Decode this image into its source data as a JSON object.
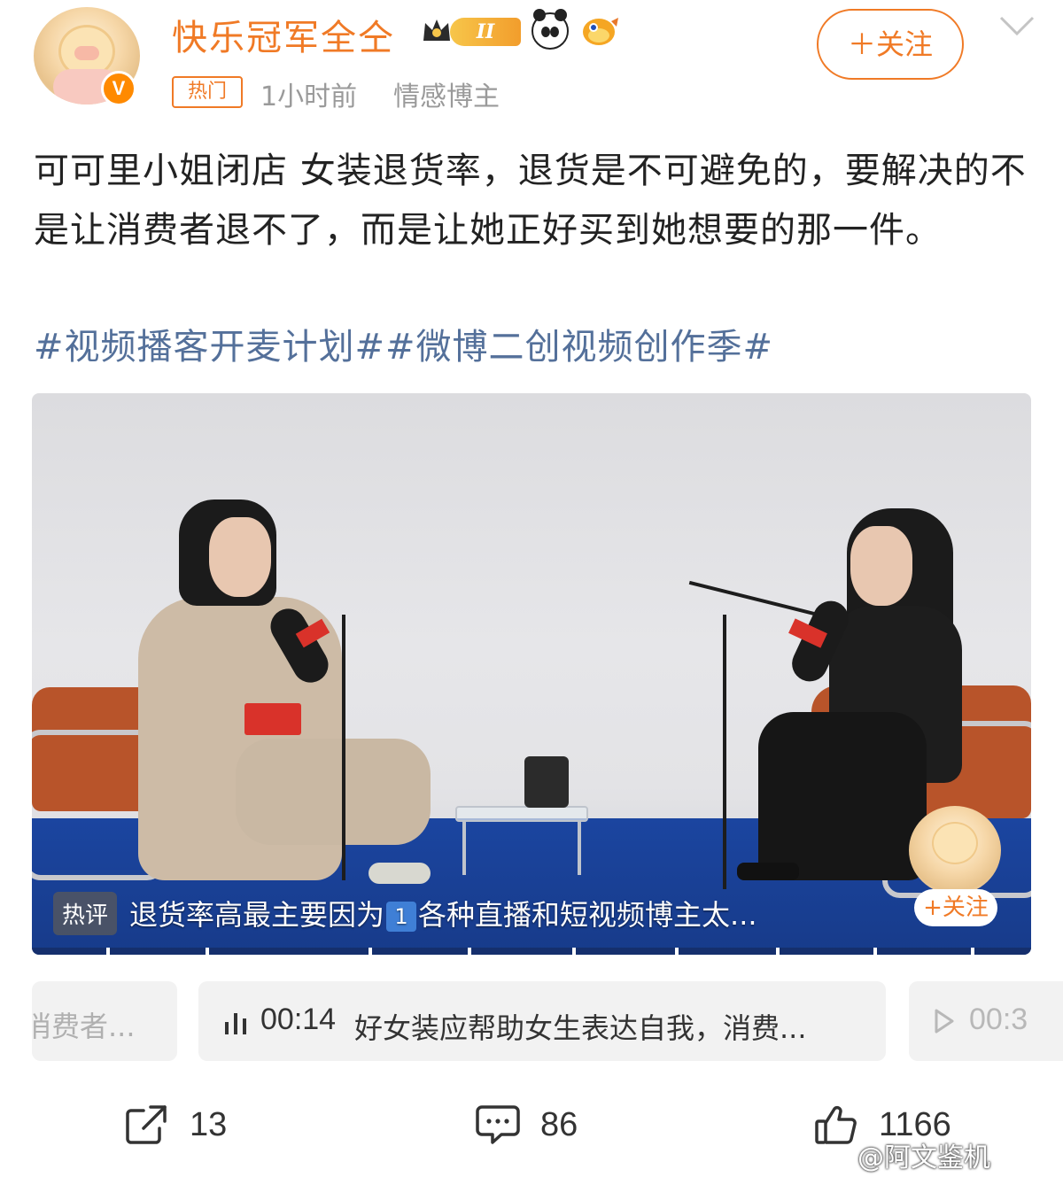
{
  "header": {
    "username": "快乐冠军全仝",
    "level_badge": "II",
    "verified_badge": "V",
    "hot_tag": "热门",
    "time": "1小时前",
    "role": "情感博主",
    "follow_label": "＋关注",
    "accent_color": "#f07a26"
  },
  "post": {
    "text": "可可里小姐闭店 女装退货率，退货是不可避免的，要解决的不是让消费者退不了，而是让她正好买到她想要的那一件。",
    "topics": [
      "#视频播客开麦计划#",
      "#微博二创视频创作季#"
    ],
    "topic_color": "#54709a"
  },
  "video": {
    "hot_comment_tag": "热评",
    "hot_comment_pre": "退货率高最主要因为",
    "hot_comment_num": "1",
    "hot_comment_post": "各种直播和短视频博主太...",
    "follow_label": "+关注"
  },
  "chapters": {
    "left_text": "消费者...",
    "mid_time": "00:14",
    "mid_text": "好女装应帮助女生表达自我，消费...",
    "right_time": "00:3"
  },
  "actions": {
    "share_count": "13",
    "comment_count": "86",
    "like_count": "1166"
  },
  "watermark": "@阿文鉴机"
}
